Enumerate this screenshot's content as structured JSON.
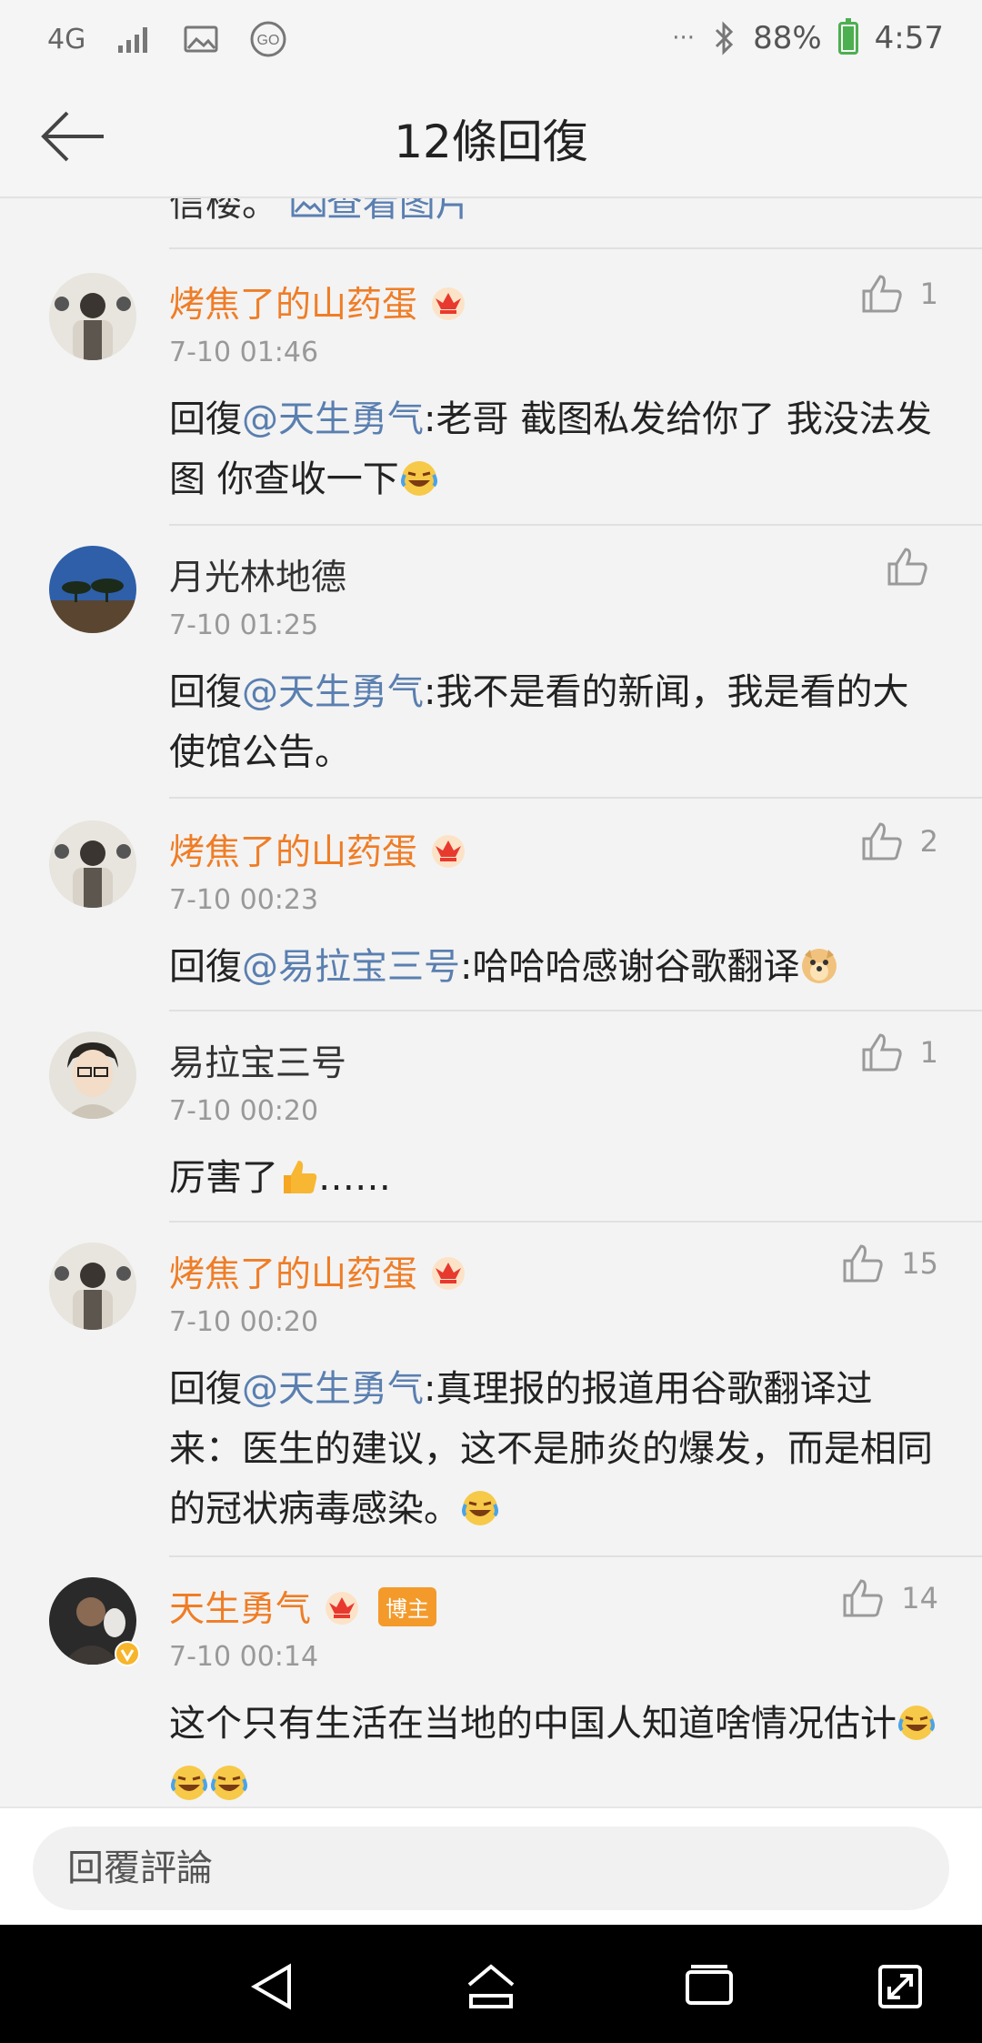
{
  "status_bar": {
    "network": "4G",
    "battery_percent": "88%",
    "time": "4:57",
    "more": "···"
  },
  "header": {
    "title": "12條回復"
  },
  "partial_top": {
    "text": "信楼。",
    "link": "查看图片"
  },
  "comments": [
    {
      "user": "烤焦了的山药蛋",
      "time": "7-10 01:46",
      "likes": "1",
      "prefix": "回復",
      "mention": "@天生勇气",
      "body": ":老哥 截图私发给你了 我没法发图 你查收一下"
    },
    {
      "user": "月光林地德",
      "time": "7-10 01:25",
      "likes": "",
      "prefix": "回復",
      "mention": "@天生勇气",
      "body": ":我不是看的新闻，我是看的大使馆公告。"
    },
    {
      "user": "烤焦了的山药蛋",
      "time": "7-10 00:23",
      "likes": "2",
      "prefix": "回復",
      "mention": "@易拉宝三号",
      "body": ":哈哈哈感谢谷歌翻译"
    },
    {
      "user": "易拉宝三号",
      "time": "7-10 00:20",
      "likes": "1",
      "prefix": "",
      "mention": "",
      "body": "厉害了",
      "suffix": "……"
    },
    {
      "user": "烤焦了的山药蛋",
      "time": "7-10 00:20",
      "likes": "15",
      "prefix": "回復",
      "mention": "@天生勇气",
      "body": ":真理报的报道用谷歌翻译过来：医生的建议，这不是肺炎的爆发，而是相同的冠状病毒感染。"
    },
    {
      "user": "天生勇气",
      "badge": "博主",
      "time": "7-10 00:14",
      "likes": "14",
      "prefix": "",
      "mention": "",
      "body": "这个只有生活在当地的中国人知道啥情况估计"
    }
  ],
  "reply_bar": {
    "placeholder": "回覆評論"
  },
  "colors": {
    "accent_orange": "#ef7d26",
    "mention_blue": "#5a7fb0",
    "badge_orange": "#f39a2b"
  },
  "icons": [
    "back-arrow-icon",
    "thumbs-up-icon",
    "crown-vip-icon",
    "laughing-crying-emoji",
    "doge-emoji",
    "thumbs-up-emoji",
    "verified-v-icon",
    "nav-back-icon",
    "nav-home-icon",
    "nav-recents-icon",
    "nav-rotate-icon"
  ]
}
